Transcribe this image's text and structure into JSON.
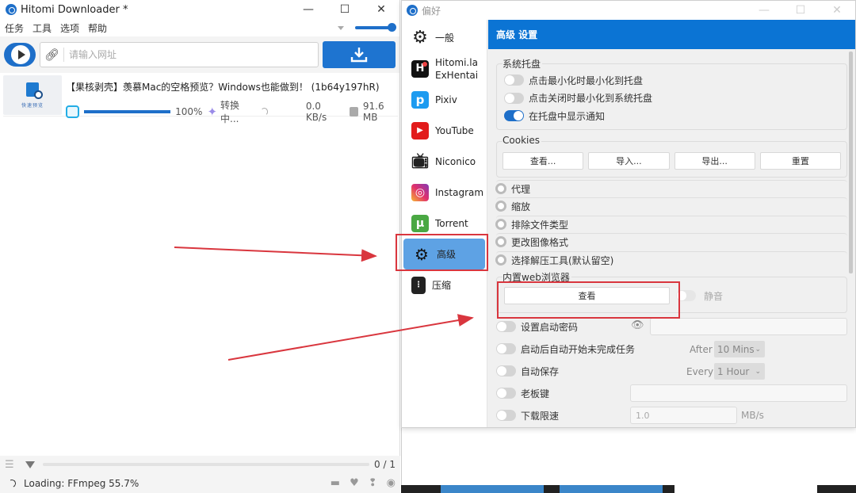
{
  "main_window": {
    "title": "Hitomi Downloader *",
    "controls": {
      "minimize": "—",
      "maximize": "☐",
      "close": "✕"
    },
    "menu": [
      "任务",
      "工具",
      "选项",
      "帮助"
    ],
    "url_placeholder": "请输入网址",
    "task": {
      "thumb_caption": "快速预览",
      "title": "【果核剥壳】羡慕Mac的空格预览？Windows也能做到！ (1b64y197hR)",
      "progress_percent": 100,
      "progress_label": "100%",
      "status": "转换中...",
      "speed": "0.0 KB/s",
      "size": "91.6 MB"
    },
    "page_count": "0 / 1",
    "loading_text": "Loading: FFmpeg 55.7%"
  },
  "pref_window": {
    "title": "偏好",
    "controls": {
      "minimize": "—",
      "maximize": "☐",
      "close": "✕"
    },
    "sidebar": [
      {
        "label": "一般",
        "icon": "gear-icon"
      },
      {
        "label": "Hitomi.la\nExHentai",
        "line1": "Hitomi.la",
        "line2": "ExHentai",
        "icon": "hitomi-icon"
      },
      {
        "label": "Pixiv",
        "icon": "pixiv-icon"
      },
      {
        "label": "YouTube",
        "icon": "youtube-icon"
      },
      {
        "label": "Niconico",
        "icon": "niconico-icon"
      },
      {
        "label": "Instagram",
        "icon": "instagram-icon"
      },
      {
        "label": "Torrent",
        "icon": "torrent-icon"
      },
      {
        "label": "高级",
        "icon": "gears-icon",
        "active": true
      },
      {
        "label": "压缩",
        "icon": "zip-icon"
      }
    ],
    "header": "高级 设置",
    "tray": {
      "label": "系统托盘",
      "options": [
        {
          "label": "点击最小化时最小化到托盘",
          "on": false
        },
        {
          "label": "点击关闭时最小化到系统托盘",
          "on": false
        },
        {
          "label": "在托盘中显示通知",
          "on": true
        }
      ]
    },
    "cookies": {
      "label": "Cookies",
      "buttons": [
        "查看...",
        "导入...",
        "导出...",
        "重置"
      ]
    },
    "collapsed_groups": [
      "代理",
      "缩放",
      "排除文件类型",
      "更改图像格式",
      "选择解压工具(默认留空)"
    ],
    "browser": {
      "label": "内置web浏览器",
      "view_button": "查看",
      "mute_label": "静音"
    },
    "settings": {
      "password": {
        "label": "设置启动密码",
        "on": false,
        "value": ""
      },
      "autostart": {
        "label": "启动后自动开始未完成任务",
        "on": false,
        "prefix": "After",
        "value": "10 Mins"
      },
      "autosave": {
        "label": "自动保存",
        "on": false,
        "prefix": "Every",
        "value": "1 Hour"
      },
      "bosskey": {
        "label": "老板键",
        "on": false,
        "value": ""
      },
      "speedlimit": {
        "label": "下载限速",
        "on": false,
        "value": "1.0",
        "unit": "MB/s"
      }
    }
  },
  "colors": {
    "accent": "#1e6fc9",
    "header_blue": "#0b74d4",
    "active_item": "#5ea2e4",
    "annotation_red": "#d9363e"
  }
}
